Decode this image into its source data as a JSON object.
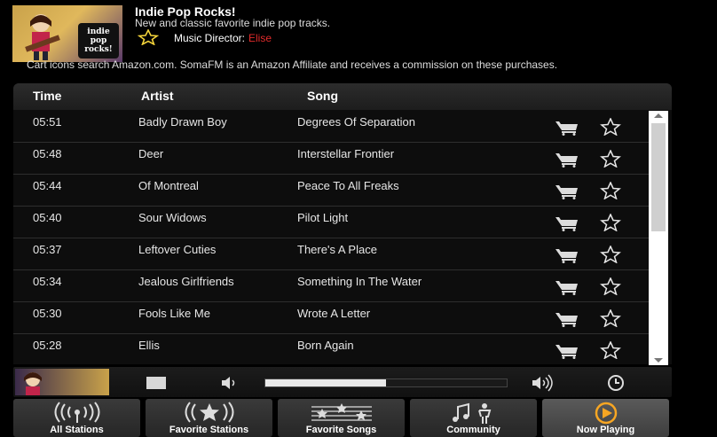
{
  "station": {
    "title": "Indie Pop Rocks!",
    "description": "New and classic favorite indie pop tracks.",
    "director_label": "Music Director:",
    "director_name": "Elise",
    "art_text": [
      "indie",
      "pop",
      "rocks!"
    ]
  },
  "affiliate_note": "Cart icons search Amazon.com. SomaFM is an Amazon Affiliate and receives a commission on these purchases.",
  "table": {
    "columns": [
      "Time",
      "Artist",
      "Song"
    ],
    "rows": [
      {
        "time": "05:51",
        "artist": "Badly Drawn Boy",
        "song": "Degrees Of Separation"
      },
      {
        "time": "05:48",
        "artist": "Deer",
        "song": "Interstellar Frontier"
      },
      {
        "time": "05:44",
        "artist": "Of Montreal",
        "song": "Peace To All Freaks"
      },
      {
        "time": "05:40",
        "artist": "Sour Widows",
        "song": "Pilot Light"
      },
      {
        "time": "05:37",
        "artist": "Leftover Cuties",
        "song": "There's A Place"
      },
      {
        "time": "05:34",
        "artist": "Jealous Girlfriends",
        "song": "Something In The Water"
      },
      {
        "time": "05:30",
        "artist": "Fools Like Me",
        "song": "Wrote A Letter"
      },
      {
        "time": "05:28",
        "artist": "Ellis",
        "song": "Born Again"
      }
    ]
  },
  "player": {
    "volume_level": 0.5
  },
  "nav": [
    {
      "label": "All Stations",
      "icon": "radio-waves-icon"
    },
    {
      "label": "Favorite Stations",
      "icon": "favorite-station-icon"
    },
    {
      "label": "Favorite Songs",
      "icon": "favorite-songs-icon"
    },
    {
      "label": "Community",
      "icon": "community-icon"
    },
    {
      "label": "Now Playing",
      "icon": "play-circle-icon"
    }
  ],
  "colors": {
    "accent": "#f7a623",
    "director_name": "#e12b2b"
  }
}
